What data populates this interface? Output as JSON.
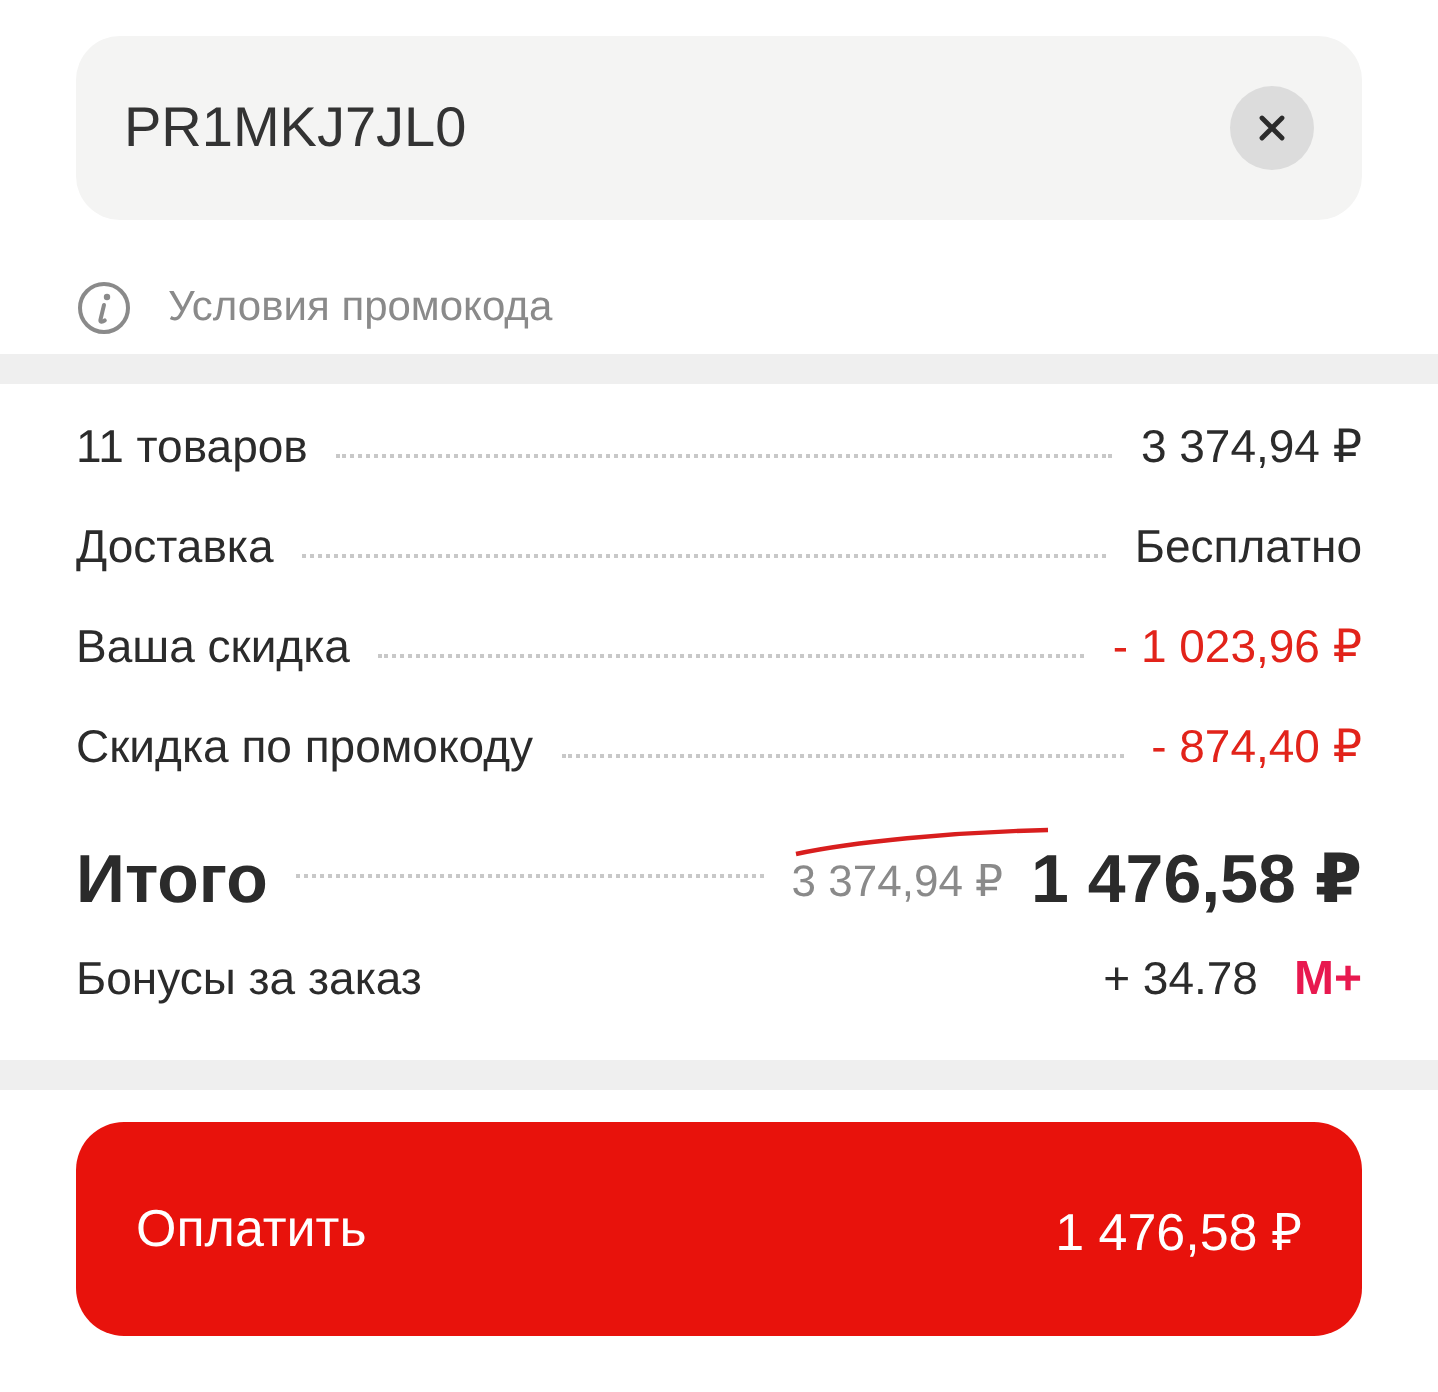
{
  "promo_field": {
    "value": "PR1MKJ7JL0"
  },
  "promo_terms_link": "Условия промокода",
  "summary_rows": [
    {
      "label": "11 товаров",
      "value": "3 374,94 ₽",
      "kind": "normal"
    },
    {
      "label": "Доставка",
      "value": "Бесплатно",
      "kind": "normal"
    },
    {
      "label": "Ваша скидка",
      "value": "- 1 023,96 ₽",
      "kind": "discount"
    },
    {
      "label": "Скидка по промокоду",
      "value": "- 874,40 ₽",
      "kind": "discount"
    }
  ],
  "total": {
    "label": "Итого",
    "old_price": "3 374,94 ₽",
    "old_price_struck": true,
    "price": "1 476,58 ₽"
  },
  "bonus": {
    "label": "Бонусы за заказ",
    "value": "+ 34.78",
    "logo": "M+"
  },
  "pay_button": {
    "label": "Оплатить",
    "amount": "1 476,58 ₽"
  }
}
